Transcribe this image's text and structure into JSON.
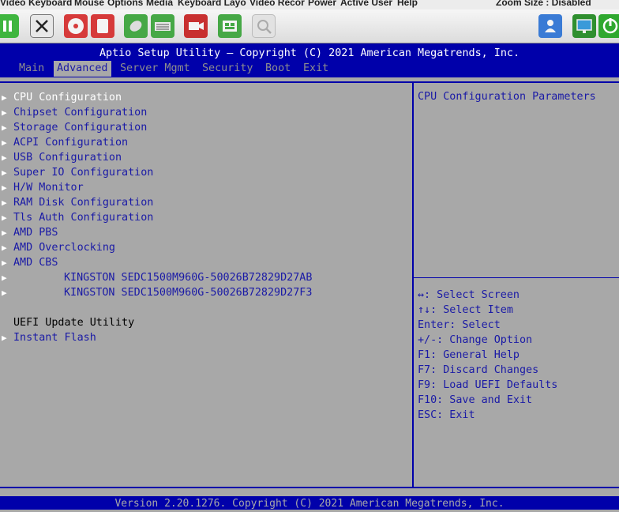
{
  "kvm": {
    "menu": [
      "Video",
      "Keyboard",
      "Mouse",
      "Options",
      "Media",
      "Keyboard Layo",
      "Video Recor",
      "Power",
      "Active User",
      "Help"
    ],
    "zoom": "Zoom Size : Disabled"
  },
  "bios": {
    "title": "Aptio Setup Utility – Copyright (C) 2021 American Megatrends, Inc.",
    "tabs": [
      "Main",
      "Advanced",
      "Server Mgmt",
      "Security",
      "Boot",
      "Exit"
    ],
    "items": [
      "CPU Configuration",
      "Chipset Configuration",
      "Storage Configuration",
      "ACPI Configuration",
      "USB Configuration",
      "Super IO Configuration",
      "H/W Monitor",
      "RAM Disk Configuration",
      "Tls Auth Configuration",
      "AMD PBS",
      "AMD Overclocking",
      "AMD CBS"
    ],
    "drives": [
      "KINGSTON SEDC1500M960G-50026B72829D27AB",
      "KINGSTON SEDC1500M960G-50026B72829D27F3"
    ],
    "section_label": "UEFI Update Utility",
    "instant_flash": "Instant Flash",
    "help_text": "CPU Configuration Parameters",
    "keys": [
      "↔: Select Screen",
      "↑↓: Select Item",
      "Enter: Select",
      "+/-: Change Option",
      "F1: General Help",
      "F7: Discard Changes",
      "F9: Load UEFI Defaults",
      "F10: Save and Exit",
      "ESC: Exit"
    ],
    "footer": "Version 2.20.1276. Copyright (C) 2021 American Megatrends, Inc."
  },
  "colors": {
    "bios_blue": "#0000aa",
    "bios_gray": "#a8a8a8",
    "text_blue": "#1a1aa6"
  }
}
